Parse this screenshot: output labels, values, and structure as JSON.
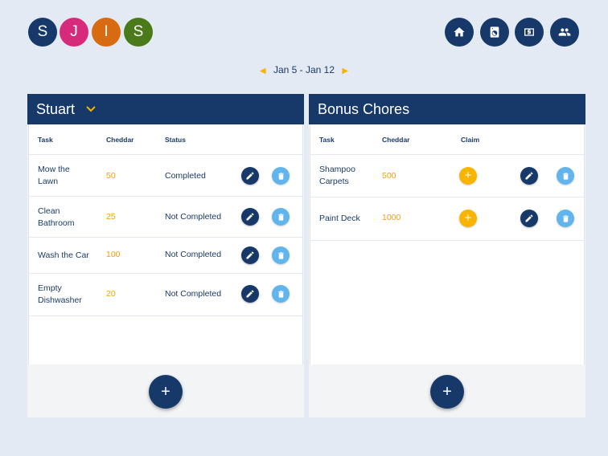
{
  "users": [
    {
      "initial": "S",
      "color": "#16396a"
    },
    {
      "initial": "J",
      "color": "#d82a7c"
    },
    {
      "initial": "I",
      "color": "#d86a12"
    },
    {
      "initial": "S",
      "color": "#4a7a1a"
    }
  ],
  "nav": [
    {
      "icon": "home-icon"
    },
    {
      "icon": "washer-icon"
    },
    {
      "icon": "cash-icon"
    },
    {
      "icon": "people-icon"
    }
  ],
  "week": {
    "label": "Jan 5 - Jan 12"
  },
  "colors": {
    "primary": "#16396a",
    "accent": "#f5a000",
    "delete": "#62b4ec",
    "claim": "#f8b400",
    "background": "#e3eaf3"
  },
  "left_panel": {
    "title": "Stuart",
    "headers": {
      "task": "Task",
      "cheddar": "Cheddar",
      "status": "Status"
    },
    "rows": [
      {
        "task": "Mow the Lawn",
        "cheddar": "50",
        "status": "Completed"
      },
      {
        "task": "Clean Bathroom",
        "cheddar": "25",
        "status": "Not Completed"
      },
      {
        "task": "Wash the Car",
        "cheddar": "100",
        "status": "Not Completed"
      },
      {
        "task": "Empty Dishwasher",
        "cheddar": "20",
        "status": "Not Completed"
      }
    ],
    "add_label": "+"
  },
  "right_panel": {
    "title": "Bonus Chores",
    "headers": {
      "task": "Task",
      "cheddar": "Cheddar",
      "claim": "Claim"
    },
    "rows": [
      {
        "task": "Shampoo Carpets",
        "cheddar": "500",
        "claim": "+"
      },
      {
        "task": "Paint Deck",
        "cheddar": "1000",
        "claim": "+"
      }
    ],
    "add_label": "+"
  }
}
